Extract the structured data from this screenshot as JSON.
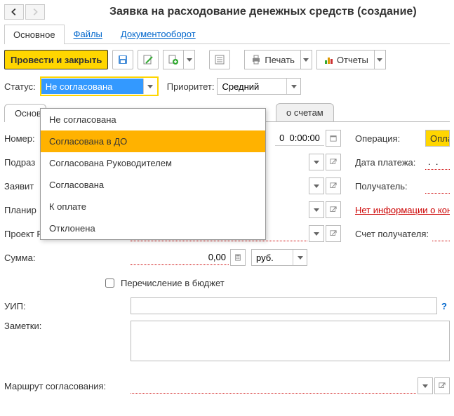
{
  "title": "Заявка на расходование денежных средств (создание)",
  "view_tabs": {
    "main": "Основное",
    "files": "Файлы",
    "docflow": "Документооборот"
  },
  "toolbar": {
    "post_close": "Провести и закрыть",
    "print": "Печать",
    "reports": "Отчеты"
  },
  "status": {
    "label": "Статус:",
    "value": "Не согласована",
    "options": [
      "Не согласована",
      "Согласована в ДО",
      "Согласована Руководителем",
      "Согласована",
      "К оплате",
      "Отклонена"
    ]
  },
  "priority": {
    "label": "Приоритет:",
    "value": "Средний"
  },
  "inner_tabs": {
    "main": "Основ",
    "accounts": "о счетам"
  },
  "fields": {
    "number_label": "Номер:",
    "number_time": "0  0:00:00",
    "subdiv_label": "Подраз",
    "applicant_label": "Заявит",
    "plan_label": "Планир",
    "project_label": "Проект РМ (СБ):",
    "sum_label": "Сумма:",
    "sum_value": "0,00",
    "currency": "руб.",
    "budget_label": "Перечисление в бюджет",
    "uip_label": "УИП:",
    "notes_label": "Заметки:",
    "route_label": "Маршрут согласования:"
  },
  "right": {
    "operation_label": "Операция:",
    "operation_value": "Оплата п",
    "paydate_label": "Дата платежа:",
    "paydate_value": ".  .",
    "recipient_label": "Получатель:",
    "noinfo": "Нет информации о контраг",
    "account_label": "Счет получателя:"
  }
}
